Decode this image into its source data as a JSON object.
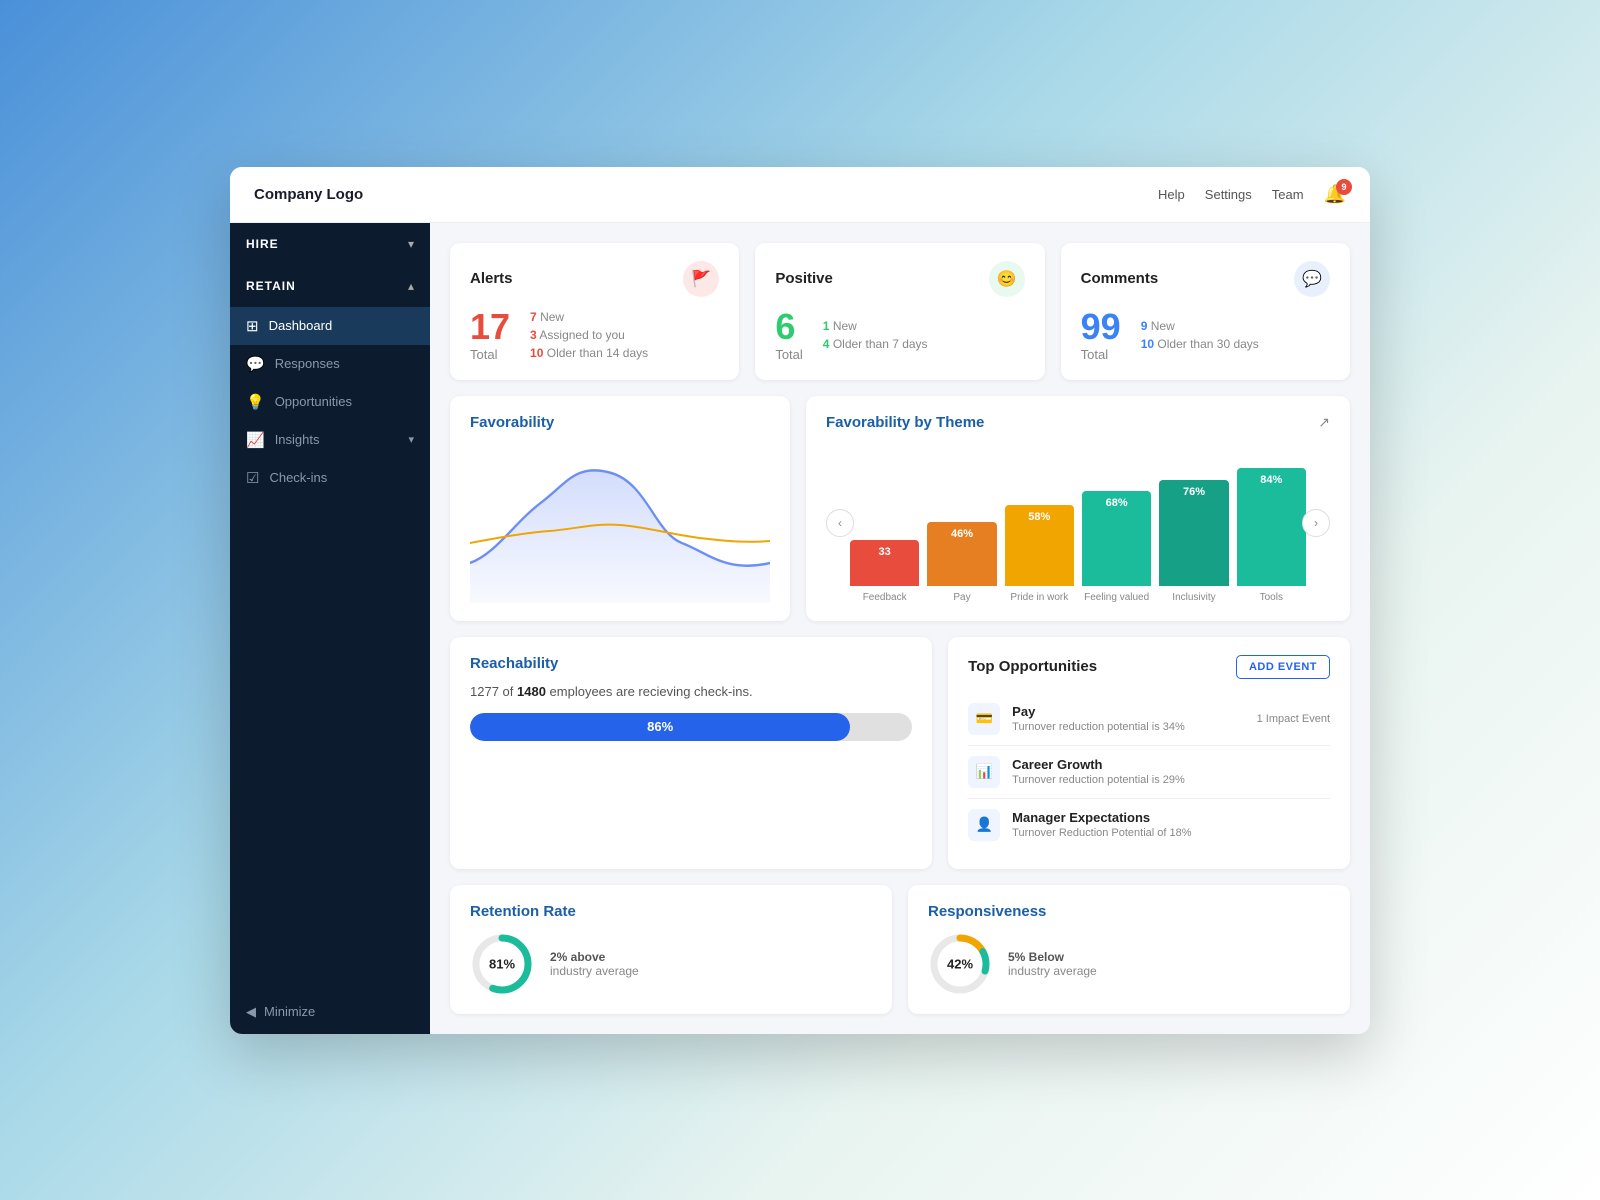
{
  "app": {
    "logo": "Company Logo",
    "nav": {
      "help": "Help",
      "settings": "Settings",
      "team": "Team",
      "bell_badge": "9"
    }
  },
  "sidebar": {
    "hire_label": "HIRE",
    "retain_label": "RETAIN",
    "items": [
      {
        "id": "dashboard",
        "label": "Dashboard",
        "icon": "⊞",
        "active": true
      },
      {
        "id": "responses",
        "label": "Responses",
        "icon": "💬",
        "active": false
      },
      {
        "id": "opportunities",
        "label": "Opportunities",
        "icon": "💡",
        "active": false
      },
      {
        "id": "insights",
        "label": "Insights",
        "icon": "📈",
        "active": false,
        "hasArrow": true
      },
      {
        "id": "checkins",
        "label": "Check-ins",
        "icon": "☑",
        "active": false
      }
    ],
    "minimize_label": "Minimize"
  },
  "alerts_card": {
    "title": "Alerts",
    "total": "17",
    "total_label": "Total",
    "stat1_num": "7",
    "stat1_text": "New",
    "stat2_num": "3",
    "stat2_text": "Assigned to you",
    "stat3_num": "10",
    "stat3_text": "Older than 14 days"
  },
  "positive_card": {
    "title": "Positive",
    "total": "6",
    "total_label": "Total",
    "stat1_num": "1",
    "stat1_text": "New",
    "stat2_num": "4",
    "stat2_text": "Older than 7 days"
  },
  "comments_card": {
    "title": "Comments",
    "total": "99",
    "total_label": "Total",
    "stat1_num": "9",
    "stat1_text": "New",
    "stat2_num": "10",
    "stat2_text": "Older than 30 days"
  },
  "favorability": {
    "title": "Favorability"
  },
  "by_theme": {
    "title": "Favorability by Theme",
    "bars": [
      {
        "label": "Feedback",
        "value": 33,
        "pct": "33",
        "color": "#e74c3c"
      },
      {
        "label": "Pay",
        "value": 46,
        "pct": "46%",
        "color": "#e67e22"
      },
      {
        "label": "Pride in work",
        "value": 58,
        "pct": "58%",
        "color": "#f0a500"
      },
      {
        "label": "Feeling valued",
        "value": 68,
        "pct": "68%",
        "color": "#1abc9c"
      },
      {
        "label": "Inclusivity",
        "value": 76,
        "pct": "76%",
        "color": "#16a085"
      },
      {
        "label": "Tools",
        "value": 84,
        "pct": "84%",
        "color": "#1abc9c"
      }
    ]
  },
  "reachability": {
    "title": "Reachability",
    "desc_pre": "1277 of ",
    "desc_bold": "1480",
    "desc_post": " employees are recieving check-ins.",
    "pct": "86%",
    "fill_width": "86"
  },
  "top_opportunities": {
    "title": "Top Opportunities",
    "add_event_btn": "ADD EVENT",
    "items": [
      {
        "name": "Pay",
        "sub": "Turnover reduction potential is 34%",
        "impact": "1 Impact Event",
        "icon": "💳"
      },
      {
        "name": "Career Growth",
        "sub": "Turnover reduction potential is 29%",
        "impact": "",
        "icon": "📊"
      },
      {
        "name": "Manager Expectations",
        "sub": "Turnover Reduction Potential of 18%",
        "impact": "",
        "icon": "👤"
      }
    ]
  },
  "retention": {
    "title": "Retention Rate",
    "pct": "81%",
    "pct_above": "2% above",
    "avg": "industry average"
  },
  "responsiveness": {
    "title": "Responsiveness",
    "pct": "42%",
    "pct_below": "5% Below",
    "avg": "industry average"
  }
}
